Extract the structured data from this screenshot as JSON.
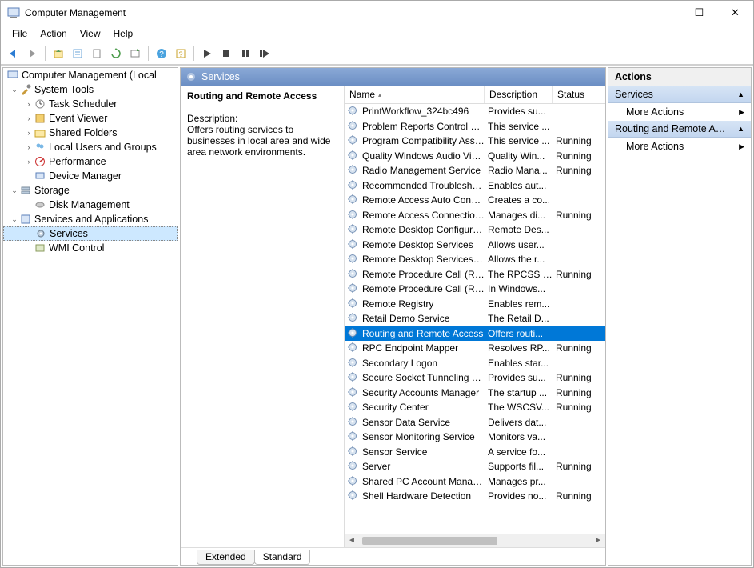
{
  "titlebar": {
    "title": "Computer Management"
  },
  "menu": {
    "file": "File",
    "action": "Action",
    "view": "View",
    "help": "Help"
  },
  "tree": {
    "root": "Computer Management (Local",
    "system_tools": "System Tools",
    "task_scheduler": "Task Scheduler",
    "event_viewer": "Event Viewer",
    "shared_folders": "Shared Folders",
    "local_users": "Local Users and Groups",
    "performance": "Performance",
    "device_manager": "Device Manager",
    "storage": "Storage",
    "disk_management": "Disk Management",
    "services_apps": "Services and Applications",
    "services": "Services",
    "wmi": "WMI Control"
  },
  "mid_header": "Services",
  "detail": {
    "name": "Routing and Remote Access",
    "desc_label": "Description:",
    "desc_text": "Offers routing services to businesses in local area and wide area network environments."
  },
  "cols": {
    "name": "Name",
    "desc": "Description",
    "status": "Status"
  },
  "tabs": {
    "extended": "Extended",
    "standard": "Standard"
  },
  "actions": {
    "header": "Actions",
    "sec1": "Services",
    "more1": "More Actions",
    "sec2": "Routing and Remote Access",
    "more2": "More Actions"
  },
  "services": [
    {
      "name": "PrintWorkflow_324bc496",
      "desc": "Provides su...",
      "status": ""
    },
    {
      "name": "Problem Reports Control Pa...",
      "desc": "This service ...",
      "status": ""
    },
    {
      "name": "Program Compatibility Assi...",
      "desc": "This service ...",
      "status": "Running"
    },
    {
      "name": "Quality Windows Audio Vid...",
      "desc": "Quality Win...",
      "status": "Running"
    },
    {
      "name": "Radio Management Service",
      "desc": "Radio Mana...",
      "status": "Running"
    },
    {
      "name": "Recommended Troublesho...",
      "desc": "Enables aut...",
      "status": ""
    },
    {
      "name": "Remote Access Auto Conne...",
      "desc": "Creates a co...",
      "status": ""
    },
    {
      "name": "Remote Access Connection...",
      "desc": "Manages di...",
      "status": "Running"
    },
    {
      "name": "Remote Desktop Configurat...",
      "desc": "Remote Des...",
      "status": ""
    },
    {
      "name": "Remote Desktop Services",
      "desc": "Allows user...",
      "status": ""
    },
    {
      "name": "Remote Desktop Services U...",
      "desc": "Allows the r...",
      "status": ""
    },
    {
      "name": "Remote Procedure Call (RPC)",
      "desc": "The RPCSS s...",
      "status": "Running"
    },
    {
      "name": "Remote Procedure Call (RP...",
      "desc": "In Windows...",
      "status": ""
    },
    {
      "name": "Remote Registry",
      "desc": "Enables rem...",
      "status": ""
    },
    {
      "name": "Retail Demo Service",
      "desc": "The Retail D...",
      "status": ""
    },
    {
      "name": "Routing and Remote Access",
      "desc": "Offers routi...",
      "status": "",
      "selected": true
    },
    {
      "name": "RPC Endpoint Mapper",
      "desc": "Resolves RP...",
      "status": "Running"
    },
    {
      "name": "Secondary Logon",
      "desc": "Enables star...",
      "status": ""
    },
    {
      "name": "Secure Socket Tunneling Pr...",
      "desc": "Provides su...",
      "status": "Running"
    },
    {
      "name": "Security Accounts Manager",
      "desc": "The startup ...",
      "status": "Running"
    },
    {
      "name": "Security Center",
      "desc": "The WSCSV...",
      "status": "Running"
    },
    {
      "name": "Sensor Data Service",
      "desc": "Delivers dat...",
      "status": ""
    },
    {
      "name": "Sensor Monitoring Service",
      "desc": "Monitors va...",
      "status": ""
    },
    {
      "name": "Sensor Service",
      "desc": "A service fo...",
      "status": ""
    },
    {
      "name": "Server",
      "desc": "Supports fil...",
      "status": "Running"
    },
    {
      "name": "Shared PC Account Manager",
      "desc": "Manages pr...",
      "status": ""
    },
    {
      "name": "Shell Hardware Detection",
      "desc": "Provides no...",
      "status": "Running"
    }
  ]
}
